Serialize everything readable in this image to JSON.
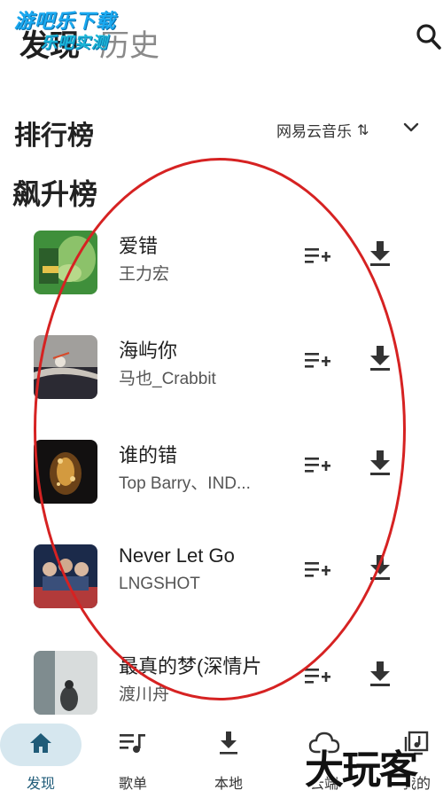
{
  "header": {
    "tab_discover": "发现",
    "tab_history": "历史",
    "watermark_line1": "游吧乐下载",
    "watermark_line2": "乐吧实测"
  },
  "ranking": {
    "title": "排行榜",
    "source": "网易云音乐",
    "sort_glyph": "⇅"
  },
  "chart": {
    "title": "飙升榜"
  },
  "songs": [
    {
      "title": "爱错",
      "artist": "王力宏",
      "cover_colors": [
        "#3f8f3b",
        "#b7d98a"
      ]
    },
    {
      "title": "海屿你",
      "artist": "马也_Crabbit",
      "cover_colors": [
        "#2b2a33",
        "#a19f9c"
      ]
    },
    {
      "title": "谁的错",
      "artist": "Top Barry、IND...",
      "cover_colors": [
        "#121010",
        "#d39a3f"
      ]
    },
    {
      "title": "Never Let Go",
      "artist": "LNGSHOT",
      "cover_colors": [
        "#1b2a4a",
        "#b23a3a"
      ]
    },
    {
      "title": "最真的梦(深情片",
      "artist": "渡川舟",
      "cover_colors": [
        "#7f8c8f",
        "#d8dcdc"
      ]
    }
  ],
  "nav": {
    "discover": "发现",
    "playlist": "歌单",
    "local": "本地",
    "cloud": "云端",
    "mine": "我的"
  },
  "watermark_bottom": "大玩客",
  "colors": {
    "accent": "#1f5b78",
    "active_pill": "#d6e7ef",
    "annotation": "#d62222"
  }
}
